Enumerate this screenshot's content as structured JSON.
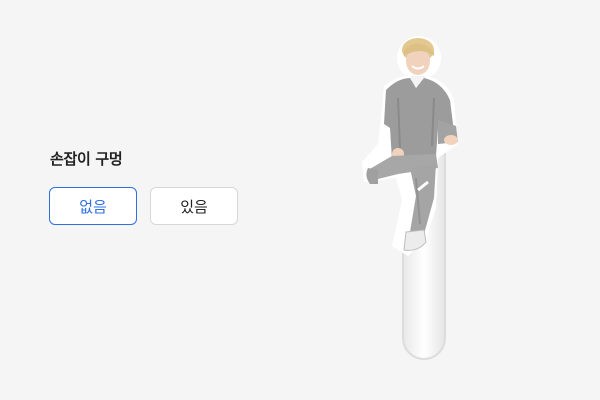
{
  "option": {
    "title": "손잡이 구멍",
    "choices": [
      {
        "label": "없음",
        "selected": true
      },
      {
        "label": "있음",
        "selected": false
      }
    ]
  },
  "colors": {
    "background": "#f5f5f5",
    "selected_accent": "#2f6fe0",
    "default_border": "#d7d7d7"
  },
  "preview": {
    "icon": "acrylic-stand-figure"
  }
}
